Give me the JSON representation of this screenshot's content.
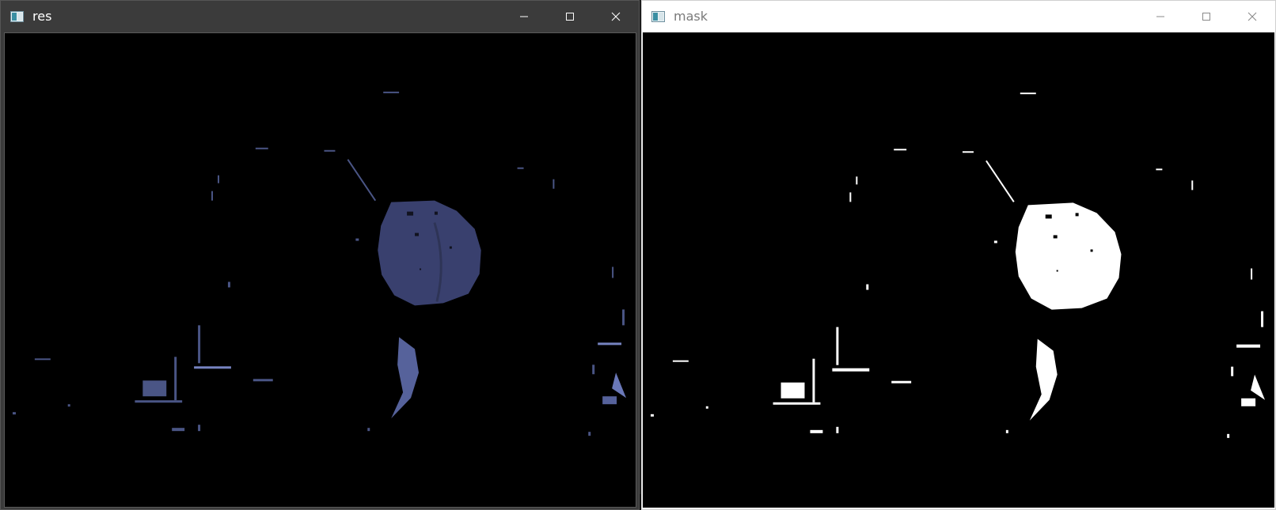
{
  "windows": {
    "res": {
      "title": "res"
    },
    "mask": {
      "title": "mask"
    }
  },
  "controls": {
    "minimize_icon": "minimize-icon",
    "maximize_icon": "maximize-icon",
    "close_icon": "close-icon"
  },
  "colors": {
    "res_titlebar": "#3b3b3b",
    "mask_titlebar": "#ffffff",
    "canvas_bg": "#000000",
    "blob_res": "#39406e",
    "blob_mask": "#ffffff"
  }
}
